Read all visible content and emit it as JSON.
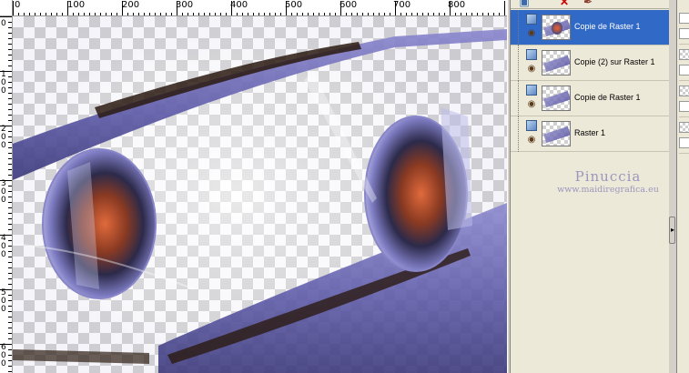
{
  "ruler": {
    "top_labels": [
      "0",
      "100",
      "200",
      "300",
      "400",
      "500",
      "600",
      "700",
      "800"
    ],
    "left_labels": [
      "0",
      "1",
      "0",
      "0",
      "0",
      "2",
      "0",
      "3",
      "0",
      "0",
      "0",
      "4",
      "0",
      "5",
      "0",
      "6",
      "0",
      "0",
      "0",
      "7"
    ]
  },
  "layers": {
    "items": [
      {
        "name": "Copie de Raster 1",
        "selected": true
      },
      {
        "name": "Copie (2) sur Raster 1",
        "selected": false
      },
      {
        "name": "Copie de Raster 1",
        "selected": false
      },
      {
        "name": "Raster 1",
        "selected": false
      }
    ]
  },
  "watermark": {
    "name": "Pinuccia",
    "url": "www.maidiregrafica.eu"
  },
  "icons": {
    "toolbar": [
      "new-layer-icon",
      "delete-layer-icon",
      "brush-icon"
    ],
    "visibility": "eye-icon",
    "layer_type": "raster-layer-icon"
  },
  "colors": {
    "selection": "#3169c6",
    "panel": "#ece9d8",
    "artwork_primary": "#6a67b4"
  }
}
